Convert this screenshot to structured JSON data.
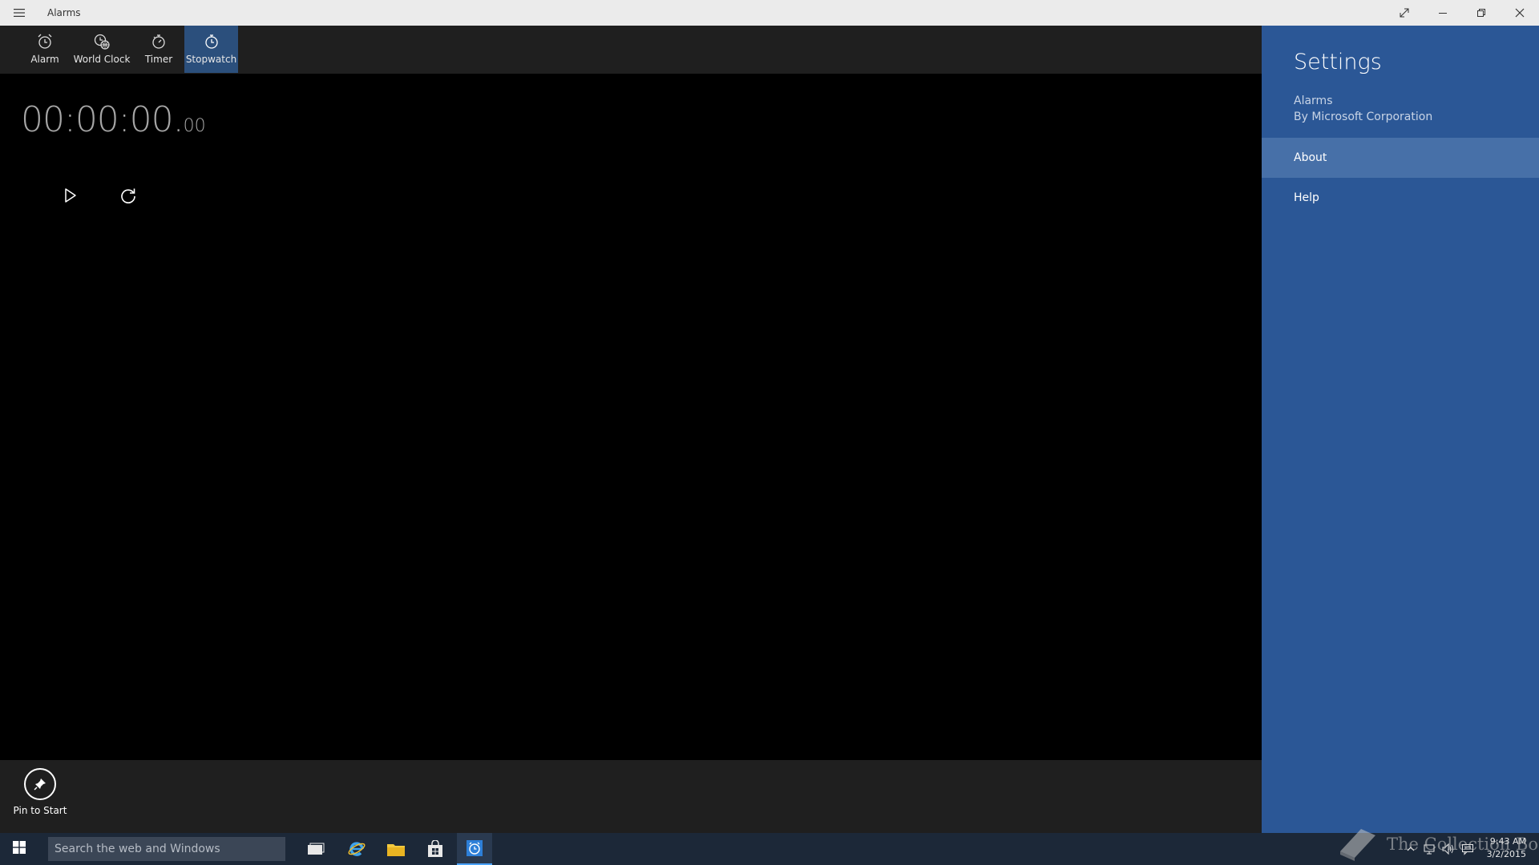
{
  "window": {
    "title": "Alarms",
    "controls": [
      "expand-icon",
      "minimize-icon",
      "restore-icon",
      "close-icon"
    ]
  },
  "tabs": [
    {
      "label": "Alarm",
      "icon": "alarm-clock-icon"
    },
    {
      "label": "World Clock",
      "icon": "world-clock-icon"
    },
    {
      "label": "Timer",
      "icon": "timer-icon"
    },
    {
      "label": "Stopwatch",
      "icon": "stopwatch-icon",
      "active": true
    }
  ],
  "stopwatch": {
    "time_main": "00:00:00.",
    "time_hundredths": "00",
    "buttons": [
      "play-icon",
      "reset-icon"
    ]
  },
  "appbar": {
    "pin_label": "Pin to Start"
  },
  "settings": {
    "title": "Settings",
    "app_name": "Alarms",
    "publisher": "By Microsoft Corporation",
    "items": [
      {
        "label": "About"
      },
      {
        "label": "Help"
      }
    ]
  },
  "taskbar": {
    "search_placeholder": "Search the web and Windows",
    "apps": [
      "task-view-icon",
      "internet-explorer-icon",
      "file-explorer-icon",
      "store-icon",
      "alarms-app-icon"
    ],
    "clock_time": "9:43 AM",
    "clock_date": "3/2/2015"
  },
  "watermark": {
    "text": "The Collection Book"
  },
  "colors": {
    "accent": "#2b4f7c",
    "settings_bg": "#2b5796",
    "taskbar_bg": "#1c2838"
  }
}
